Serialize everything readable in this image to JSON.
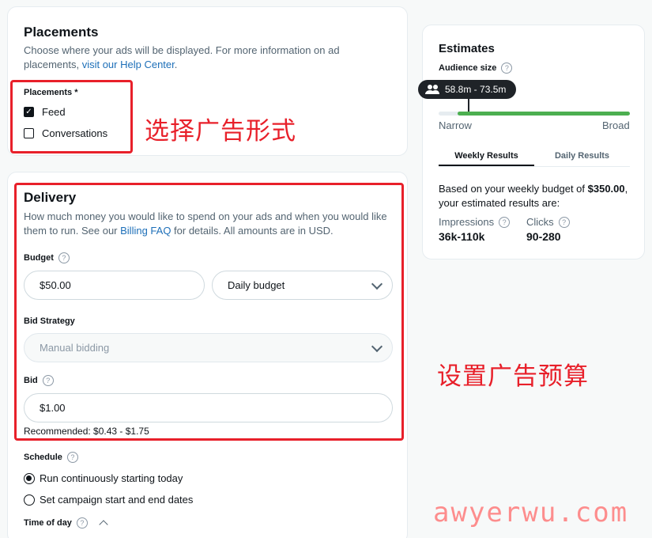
{
  "placements": {
    "title": "Placements",
    "description_prefix": "Choose where your ads will be displayed. For more information on ad placements, ",
    "help_link": "visit our Help Center",
    "description_suffix": ".",
    "field_label": "Placements *",
    "options": [
      {
        "label": "Feed",
        "checked": true
      },
      {
        "label": "Conversations",
        "checked": false
      }
    ],
    "annotation": "选择广告形式"
  },
  "delivery": {
    "title": "Delivery",
    "description_prefix": "How much money you would like to spend on your ads and when you would like them to run. See our ",
    "billing_link": "Billing FAQ",
    "description_suffix": " for details. All amounts are in USD.",
    "budget": {
      "label": "Budget",
      "value": "$50.00",
      "type_value": "Daily budget"
    },
    "bid_strategy": {
      "label": "Bid Strategy",
      "value": "Manual bidding"
    },
    "bid": {
      "label": "Bid",
      "value": "$1.00",
      "recommended": "Recommended: $0.43 - $1.75"
    },
    "schedule": {
      "label": "Schedule",
      "options": [
        {
          "label": "Run continuously starting today",
          "selected": true
        },
        {
          "label": "Set campaign start and end dates",
          "selected": false
        }
      ]
    },
    "time_of_day_label": "Time of day",
    "annotation": "设置广告预算"
  },
  "estimates": {
    "title": "Estimates",
    "audience_size_label": "Audience size",
    "audience_range": "58.8m - 73.5m",
    "scale_min": "Narrow",
    "scale_max": "Broad",
    "audience_level": 0.02,
    "tabs": [
      "Weekly Results",
      "Daily Results"
    ],
    "active_tab": "Weekly Results",
    "summary_prefix": "Based on your weekly budget of ",
    "summary_budget": "$350.00",
    "summary_suffix": ", your estimated results are:",
    "impressions_label": "Impressions",
    "impressions_value": "36k-110k",
    "clicks_label": "Clicks",
    "clicks_value": "90-280"
  },
  "watermark": "awyerwu.com",
  "colors": {
    "annotation_red": "#e8202a",
    "link_blue": "#1d6fb8",
    "audience_green": "#4caf50"
  }
}
